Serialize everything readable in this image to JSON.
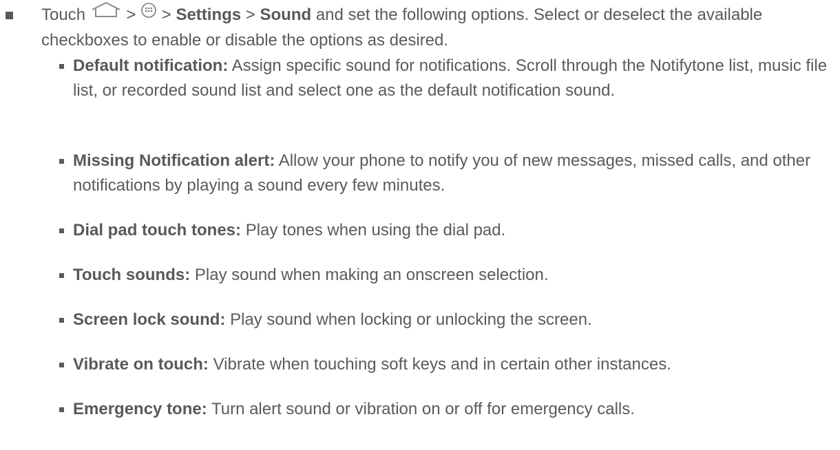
{
  "intro": {
    "prefix": "Touch",
    "sep1": ">",
    "sep2": ">",
    "settings": "Settings",
    "sep3": ">",
    "sound": "Sound",
    "rest": "and set the following options. Select or deselect the available checkboxes to enable or disable the options as desired.",
    "home_icon": "home-icon",
    "apps_icon": "apps-icon"
  },
  "options": [
    {
      "term": "Default notification:",
      "desc": "Assign specific sound for notifications. Scroll through the Notifytone list, music file list, or recorded sound list and select one as the default notification sound."
    },
    {
      "term": "Missing Notification alert:",
      "desc": "Allow your phone to notify you of new messages, missed calls, and other notifications by playing a sound every few minutes."
    },
    {
      "term": "Dial pad touch tones:",
      "desc": "Play tones when using the dial pad."
    },
    {
      "term": "Touch sounds:",
      "desc": "Play sound when making an onscreen selection."
    },
    {
      "term": "Screen lock sound:",
      "desc": "Play sound when locking or unlocking the screen."
    },
    {
      "term": "Vibrate on touch:",
      "desc": "Vibrate when touching soft keys and in certain other instances."
    },
    {
      "term": "Emergency tone:",
      "desc": "Turn alert sound or vibration on or off for emergency calls."
    }
  ]
}
